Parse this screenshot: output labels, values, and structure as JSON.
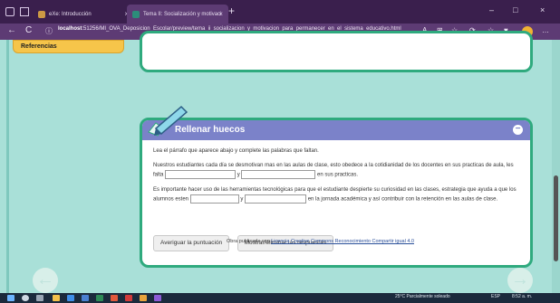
{
  "browser": {
    "tabs": [
      {
        "title": "eXe: Introducción",
        "close": "×"
      },
      {
        "title": "Tema II: Socialización y motivaci",
        "close": "×"
      }
    ],
    "new_tab": "+",
    "window_controls": [
      "–",
      "□",
      "×"
    ],
    "nav": {
      "back": "←",
      "refresh": "C",
      "info": "ⓘ"
    },
    "url_host": "localhost",
    "url_path": ":51256/MI_OVA_Deposicion_Escolar/preview/tema_ii_socializacion_y_motivacion_para_permanecer_en_el_sistema_educativo.html",
    "bar_icons": [
      "A",
      "⊞",
      "☆",
      "⟳",
      "☆",
      "♥",
      "…"
    ]
  },
  "sidebar": {
    "references_label": "Referencias"
  },
  "activity": {
    "title": "Rellenar huecos",
    "collapse_icon": "−",
    "instruction": "Lea el párrafo que aparece abajo y complete las palabras que faltan.",
    "para1_part1": "Nuestros estudiantes cada día se desmotivan mas en las aulas de clase, esto obedece a la cotidianidad de los docentes en sus practicas de aula, les falta",
    "para1_sep": "y",
    "para1_end": "en sus practicas.",
    "para2_part1": "Es importante hacer uso de las herramientas tecnológicas para que el estudiante despierte su curiosidad en las clases, estrategia que ayuda a que los alumnos esten",
    "para2_sep": "y",
    "para2_end": "en la jornada académica y así contribuir con la retención en las aulas de clase.",
    "blanks": [
      "",
      "",
      "",
      ""
    ],
    "buttons": {
      "score": "Averiguar la puntuación",
      "toggle": "Mostrar/eliminar las respuestas"
    }
  },
  "footer": {
    "prefix": "Obra publicada con",
    "license_link": "Licencia Creative Commons Reconocimiento Compartir igual 4.0"
  },
  "navigation": {
    "prev": "←",
    "next": "→"
  },
  "taskbar": {
    "tray_text": "25°C Parcialmente soleado",
    "lang": "ESP",
    "time": "8:52 a. m."
  }
}
